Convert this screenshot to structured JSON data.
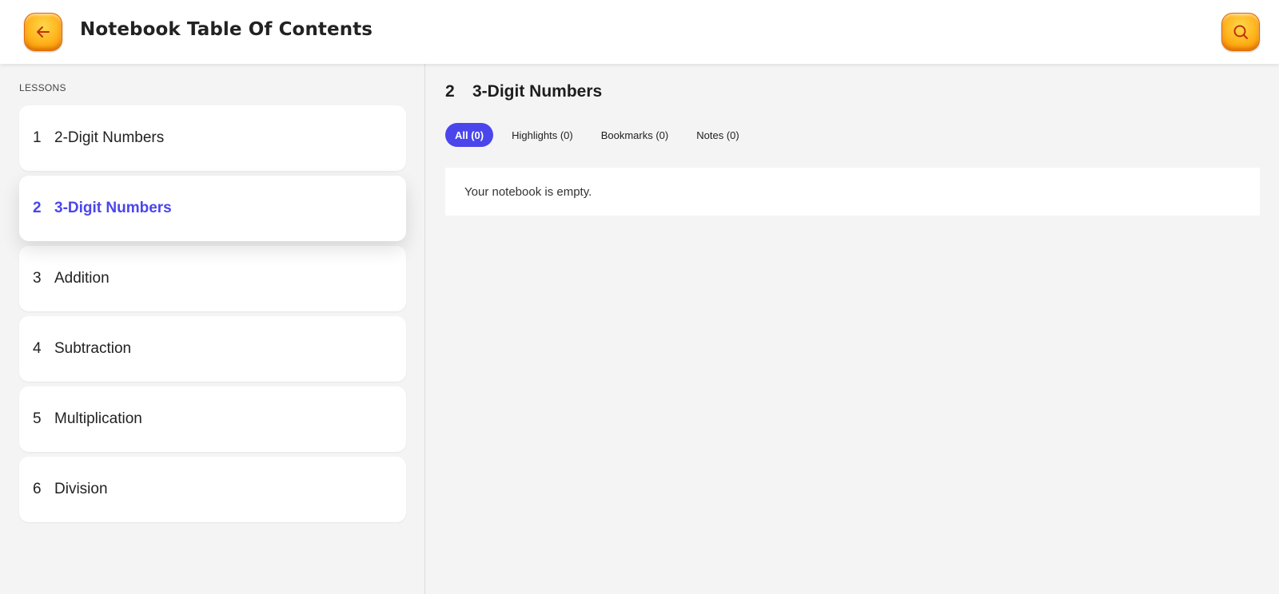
{
  "header": {
    "title": "Notebook Table Of Contents",
    "back_icon": "arrow-left-icon",
    "search_icon": "search-icon",
    "accent": "#ffb21a"
  },
  "sidebar": {
    "section_label": "LESSONS",
    "lessons": [
      {
        "num": "1",
        "name": "2-Digit Numbers"
      },
      {
        "num": "2",
        "name": "3-Digit Numbers"
      },
      {
        "num": "3",
        "name": "Addition"
      },
      {
        "num": "4",
        "name": "Subtraction"
      },
      {
        "num": "5",
        "name": "Multiplication"
      },
      {
        "num": "6",
        "name": "Division"
      }
    ],
    "active_color": "#4a46ec"
  },
  "main": {
    "lesson_num": "2",
    "lesson_title": "3-Digit Numbers",
    "tabs": [
      {
        "label": "All (0)"
      },
      {
        "label": "Highlights (0)"
      },
      {
        "label": "Bookmarks (0)"
      },
      {
        "label": "Notes (0)"
      }
    ],
    "empty_message": "Your notebook is empty."
  }
}
